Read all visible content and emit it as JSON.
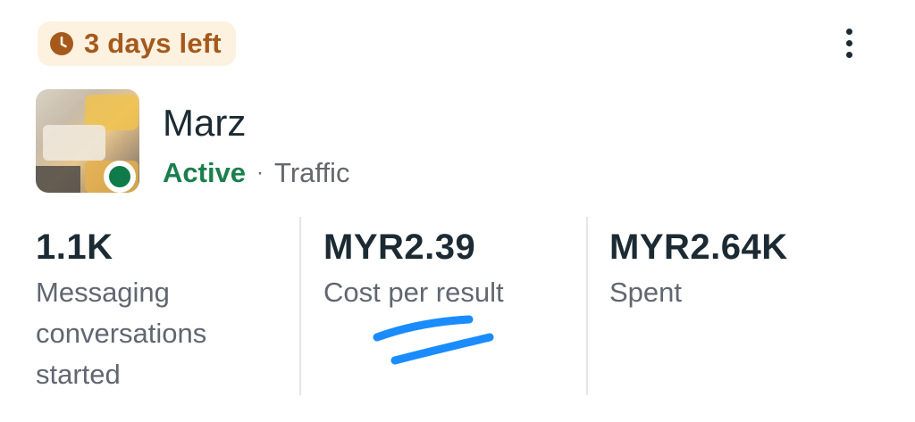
{
  "badge": {
    "icon": "clock-icon",
    "text": "3 days left",
    "color": "#a5591b",
    "background": "#fdf1e0"
  },
  "menu": {
    "icon": "more-vertical-icon"
  },
  "campaign": {
    "name": "Marz",
    "status": "Active",
    "status_color": "#1a7f4d",
    "separator": "·",
    "objective": "Traffic"
  },
  "metrics": [
    {
      "value": "1.1K",
      "label": "Messaging conversations started"
    },
    {
      "value": "MYR2.39",
      "label": "Cost per result"
    },
    {
      "value": "MYR2.64K",
      "label": "Spent"
    }
  ],
  "annotation": {
    "color": "#1a8cff"
  }
}
